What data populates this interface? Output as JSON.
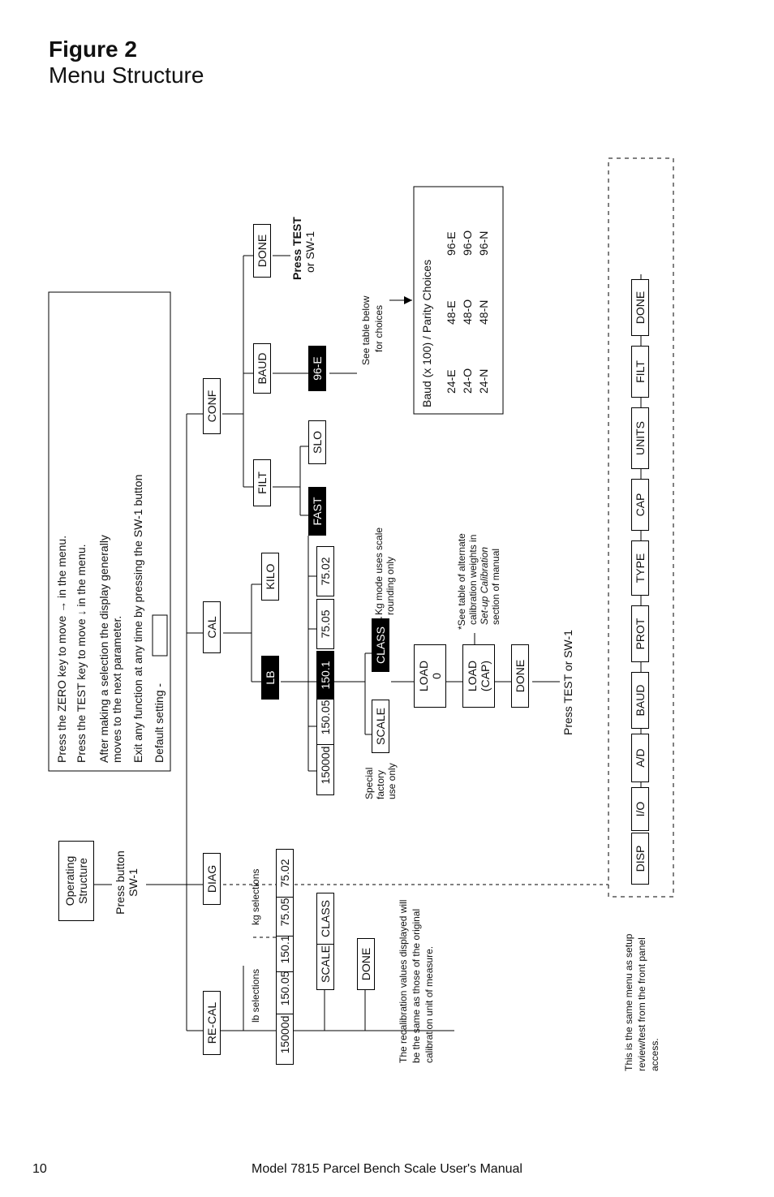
{
  "figure": {
    "number": "Figure 2",
    "name": "Menu Structure"
  },
  "page": {
    "num": "10",
    "footer": "Model 7815 Parcel Bench Scale User's Manual"
  },
  "legend": {
    "zero": "Press the ZERO key to move → in the menu.",
    "test": "Press the TEST key to move ↓ in the menu.",
    "after1": "After making a selection the display generally",
    "after2": "moves to the next parameter.",
    "exit": "Exit any function at any time by pressing the SW-1 button",
    "default": "Default setting -"
  },
  "root": {
    "oper1": "Operating",
    "oper2": "Structure",
    "press1": "Press button",
    "press2": "SW-1"
  },
  "top": {
    "diag": "DIAG",
    "recal": "RE-CAL",
    "cal": "CAL",
    "conf": "CONF"
  },
  "recal": {
    "lbsel": "lb selections",
    "kgsel": "kg selections",
    "r0": "15000d",
    "r1": "150.05",
    "r2": "150.1",
    "r3": "75.05",
    "r4": "75.02",
    "scale": "SCALE",
    "class": "CLASS",
    "done": "DONE",
    "note1": "The recalibration values displayed will",
    "note2": "be the same as those of the original",
    "note3": "calibration unit of measure."
  },
  "cal": {
    "lb": "LB",
    "kilo": "KILO",
    "row": {
      "r0": "15000d",
      "r1": "150.05",
      "r2": "150.1",
      "r3": "75.05",
      "r4": "75.02"
    },
    "scale": "SCALE",
    "class": "CLASS",
    "spec1": "Special",
    "spec2": "factory",
    "spec3": "use only",
    "kgnote1": "Kg mode uses scale",
    "kgnote2": "rounding only",
    "load0a": "LOAD",
    "load0b": "0",
    "loadcapa": "LOAD",
    "loadcapb": "(CAP)",
    "done": "DONE",
    "star1": "*See table of alternate",
    "star2": "calibration weights in",
    "star3": "Set-up Calibration",
    "star4": "section of manual",
    "end": "Press TEST or SW-1"
  },
  "conf": {
    "filt": "FILT",
    "baud": "BAUD",
    "done": "DONE",
    "fast": "FAST",
    "slo": "SLO",
    "item": "96-E",
    "pressA": "Press TEST",
    "pressB": "or SW-1",
    "see1": "See table below",
    "see2": "for choices",
    "tbl_head": "Baud (x 100) / Parity Choices",
    "t11": "24-E",
    "t12": "48-E",
    "t13": "96-E",
    "t21": "24-O",
    "t22": "48-O",
    "t23": "96-O",
    "t31": "24-N",
    "t32": "48-N",
    "t33": "96-N"
  },
  "bottom": {
    "note1": "This is the same menu as setup",
    "note2": "review/test from the front panel",
    "note3": "access.",
    "disp": "DISP",
    "io": "I/O",
    "ad": "A/D",
    "baud": "BAUD",
    "prot": "PROT",
    "type": "TYPE",
    "cap": "CAP",
    "units": "UNITS",
    "filt": "FILT",
    "done": "DONE"
  }
}
